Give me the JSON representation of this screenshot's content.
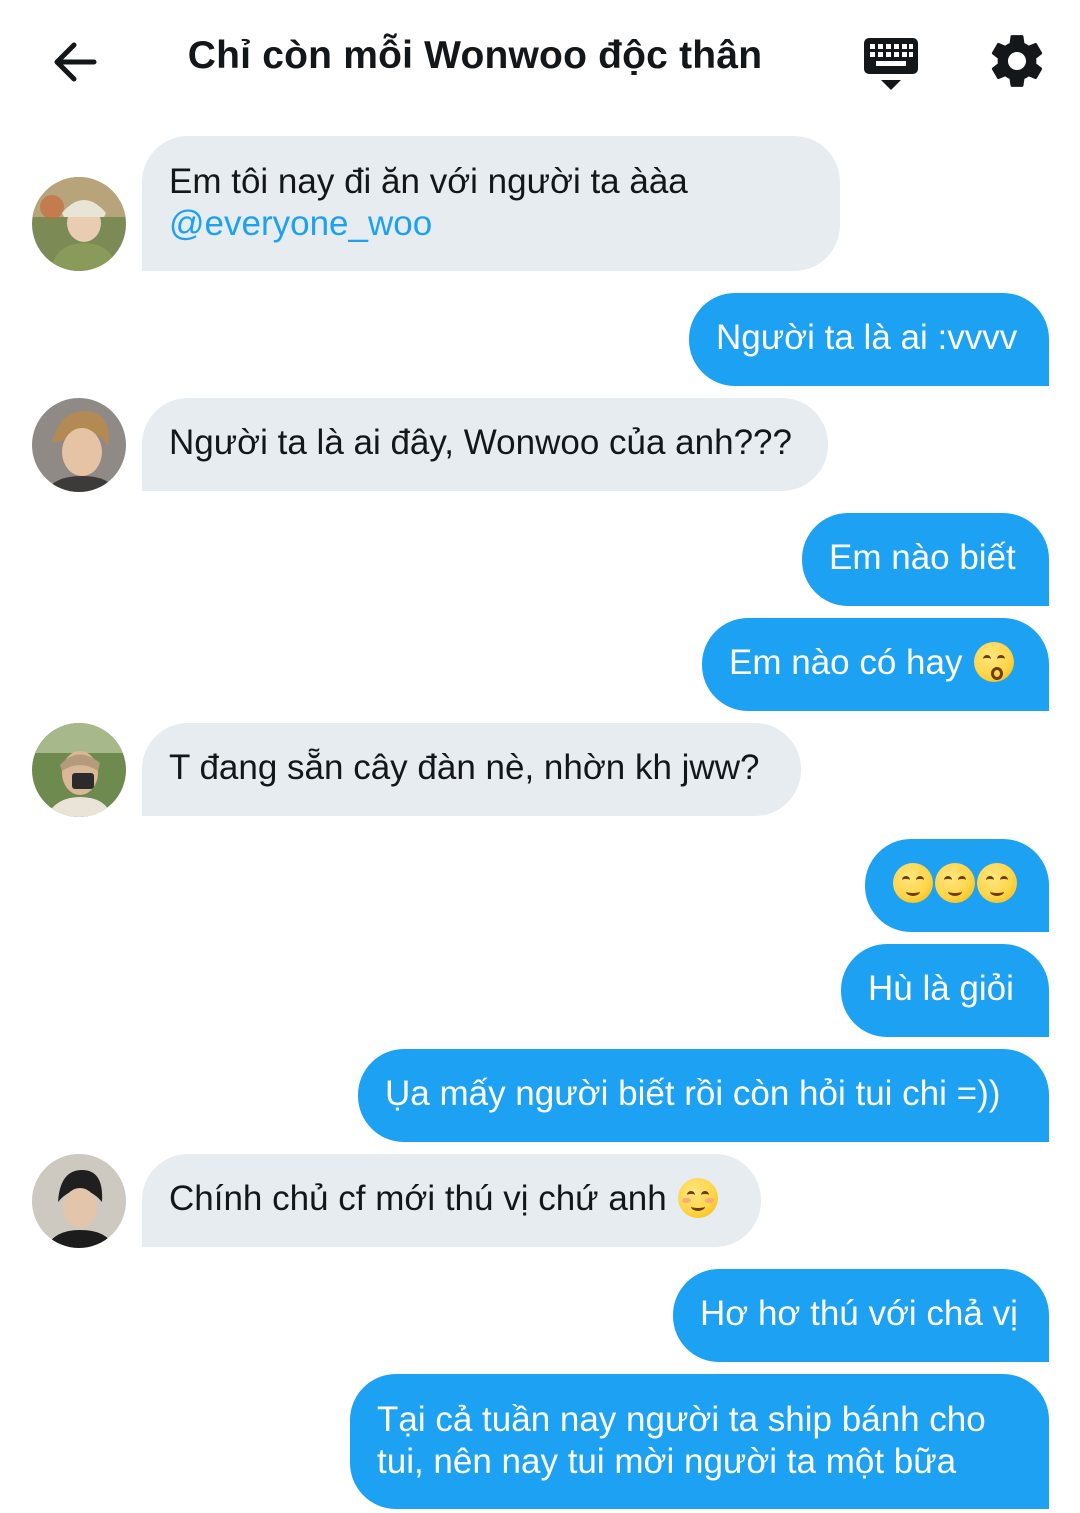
{
  "header": {
    "title": "Chỉ còn mỗi Wonwoo độc thân",
    "back_icon": "arrow-left-icon",
    "keyboard_icon": "keyboard-icon",
    "settings_icon": "gear-icon"
  },
  "colors": {
    "outgoing_bubble": "#1da1f2",
    "incoming_bubble": "#e6ecf0",
    "mention": "#1da1f2",
    "title_text": "#14171a"
  },
  "messages": [
    {
      "side": "in",
      "line1": "Em tôi nay đi ăn với người ta ààa",
      "mention": "@everyone_woo"
    },
    {
      "side": "out",
      "text": "Người ta là ai :vvvv"
    },
    {
      "side": "in",
      "text": "Người ta là ai đây, Wonwoo của anh???"
    },
    {
      "side": "out",
      "text": "Em nào biết"
    },
    {
      "side": "out",
      "text": "Em nào có hay",
      "emoji": "kissing-face"
    },
    {
      "side": "in",
      "text": "T đang sẵn cây đàn nè, nhờn kh jww?"
    },
    {
      "side": "out",
      "text": "",
      "emoji": "smirking-face x3"
    },
    {
      "side": "out",
      "text": "Hù là giỏi"
    },
    {
      "side": "out",
      "text": "Ụa mấy người biết rồi còn hỏi tui chi =))"
    },
    {
      "side": "in",
      "text": "Chính chủ cf mới thú vị chứ anh",
      "emoji": "smiling-face"
    },
    {
      "side": "out",
      "text": "Hơ hơ thú với chả vị"
    },
    {
      "side": "out",
      "line1": "Tại cả tuần nay người ta ship bánh cho",
      "line2": "tui, nên nay tui mời người ta một bữa"
    }
  ]
}
